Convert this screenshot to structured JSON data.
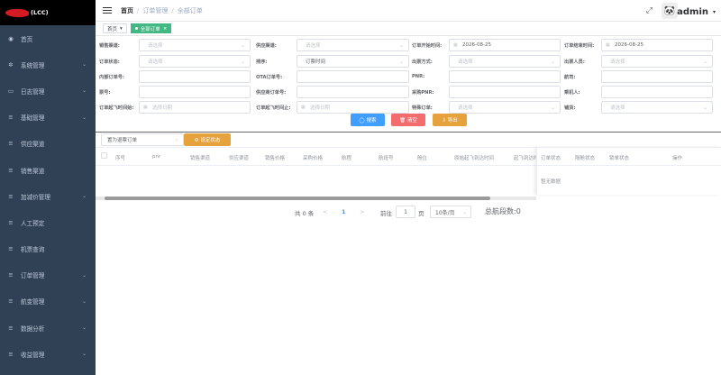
{
  "logo": {
    "text": "(LCC)"
  },
  "sidebar": {
    "items": [
      {
        "label": "首页",
        "icon": "dashboard-icon",
        "glyph": "◉",
        "has_children": false
      },
      {
        "label": "系统管理",
        "icon": "gear-icon",
        "glyph": "✲",
        "has_children": true
      },
      {
        "label": "日志管理",
        "icon": "log-icon",
        "glyph": "▭",
        "has_children": true
      },
      {
        "label": "基础管理",
        "icon": "list-icon",
        "glyph": "≡",
        "has_children": true
      },
      {
        "label": "供应渠道",
        "icon": "list-icon",
        "glyph": "≡",
        "has_children": false
      },
      {
        "label": "销售渠道",
        "icon": "list-icon",
        "glyph": "≡",
        "has_children": false
      },
      {
        "label": "加减价管理",
        "icon": "list-icon",
        "glyph": "≡",
        "has_children": true
      },
      {
        "label": "人工预定",
        "icon": "list-icon",
        "glyph": "≡",
        "has_children": false
      },
      {
        "label": "机票查询",
        "icon": "list-icon",
        "glyph": "≡",
        "has_children": false
      },
      {
        "label": "订单管理",
        "icon": "list-icon",
        "glyph": "≡",
        "has_children": true
      },
      {
        "label": "航变管理",
        "icon": "list-icon",
        "glyph": "≡",
        "has_children": true
      },
      {
        "label": "数据分析",
        "icon": "list-icon",
        "glyph": "≡",
        "has_children": true
      },
      {
        "label": "收益管理",
        "icon": "list-icon",
        "glyph": "≡",
        "has_children": true
      }
    ]
  },
  "header": {
    "breadcrumb": [
      "首页",
      "订单管理",
      "全部订单"
    ],
    "separator": "/",
    "username": "admin"
  },
  "tags": {
    "home": "首页",
    "active": "全部订单"
  },
  "filters": {
    "row1": {
      "sales_channel": "销售渠道:",
      "sales_channel_ph": "请选择",
      "supply_channel": "供应渠道:",
      "supply_channel_ph": "请选择",
      "order_start": "订单开始时间:",
      "order_start_val": "2026-08-25",
      "order_end": "订单结束时间:",
      "order_end_val": "2026-08-25"
    },
    "row2": {
      "order_status": "订单状态:",
      "order_status_ph": "请选择",
      "sort": "排序:",
      "sort_val": "订票时间",
      "ticket_method": "出票方式:",
      "ticket_method_ph": "请选择",
      "ticket_person": "出票人员:",
      "ticket_person_ph": "请选择"
    },
    "row3": {
      "internal_no": "内部订单号:",
      "ota_no": "OTA订单号:",
      "pnr": "PNR:",
      "flight_no": "航司:"
    },
    "row4": {
      "ticket_no": "票号:",
      "supplier_no": "供应商订单号:",
      "purchase_pnr": "采购PNR:",
      "passenger": "乘机人:"
    },
    "row5": {
      "dep_from": "订单起飞时间始:",
      "dep_from_ph": "选择日期",
      "dep_to": "订单起飞时间止:",
      "dep_to_ph": "选择日期",
      "special": "特殊订单:",
      "special_ph": "请选择",
      "cabin": "铺货:",
      "cabin_ph": "请选择"
    }
  },
  "buttons": {
    "search": "◯ 搜索",
    "clear": "🗑 清空",
    "export": "⇩ 导出"
  },
  "toolbar": {
    "bulk_select": "置为退票订单",
    "set_status": "⚙ 设定状态"
  },
  "table": {
    "columns": [
      "序号",
      "pnr",
      "销售渠道",
      "供应渠道",
      "销售价格",
      "采购价格",
      "航程",
      "航班号",
      "舱位",
      "原始起飞到达时间",
      "起飞到达时"
    ],
    "fixed_columns": [
      "订单状态",
      "隔舱状态",
      "锁单状态",
      "操作"
    ],
    "empty_text": "暂无数据"
  },
  "pager": {
    "total": "共 0 条",
    "prev": "<",
    "page": "1",
    "next": ">",
    "goto": "前往",
    "goto_val": "1",
    "page_unit": "页",
    "page_size": "10条/页",
    "segments": "总航段数:0"
  }
}
